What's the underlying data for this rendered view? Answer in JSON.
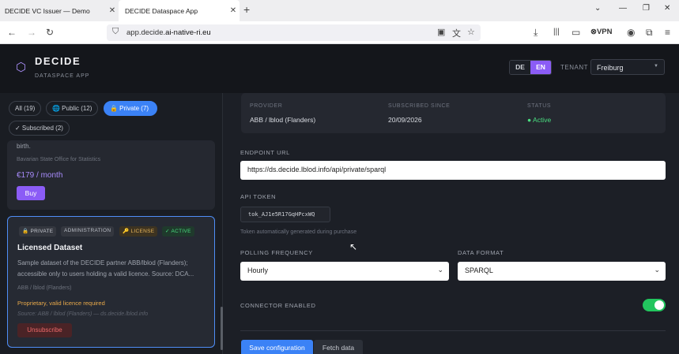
{
  "browser": {
    "tabs": [
      {
        "title": "DECIDE VC Issuer — Demo",
        "active": false
      },
      {
        "title": "DECIDE Dataspace App",
        "active": true
      }
    ],
    "url_prefix": "app.decide.",
    "url_domain": "ai-native-ri.eu",
    "vpn_label": "VPN"
  },
  "header": {
    "brand": "DECIDE",
    "subtitle": "DATASPACE APP",
    "lang_de": "DE",
    "lang_en": "EN",
    "tenant_label": "TENANT",
    "tenant_value": "Freiburg"
  },
  "filters": {
    "all": "All (19)",
    "public": "🌐 Public (12)",
    "private": "🔒 Private (7)",
    "subscribed": "✓ Subscribed (2)"
  },
  "card_prev": {
    "text_tail": "birth.",
    "org": "Bavarian State Office for Statistics",
    "price": "€179 / month",
    "buy_label": "Buy"
  },
  "card_licensed": {
    "badge_private": "🔒 PRIVATE",
    "badge_admin": "ADMINISTRATION",
    "badge_license": "🔑 LICENSE",
    "badge_active": "✓ ACTIVE",
    "title": "Licensed Dataset",
    "description": "Sample dataset of the DECIDE partner ABB/lblod (Flanders); accessible only to users holding a valid licence. Source: DCA...",
    "org": "ABB / lblod (Flanders)",
    "license_note": "Proprietary, valid licence required",
    "source": "Source: ABB / lblod (Flanders) — ds.decide.lblod.info",
    "unsubscribe_label": "Unsubscribe"
  },
  "details": {
    "provider_label": "PROVIDER",
    "provider_value": "ABB / lblod (Flanders)",
    "since_label": "SUBSCRIBED SINCE",
    "since_value": "20/09/2026",
    "status_label": "STATUS",
    "status_value": "● Active",
    "endpoint_label": "ENDPOINT URL",
    "endpoint_value": "https://ds.decide.lblod.info/api/private/sparql",
    "token_label": "API TOKEN",
    "token_value": "tok_AJ1e5R17GqHPcxWQ",
    "token_hint": "Token automatically generated during purchase",
    "polling_label": "POLLING FREQUENCY",
    "polling_value": "Hourly",
    "format_label": "DATA FORMAT",
    "format_value": "SPARQL",
    "connector_label": "CONNECTOR ENABLED",
    "connector_enabled": true,
    "save_label": "Save configuration",
    "fetch_label": "Fetch data"
  },
  "colors": {
    "accent_purple": "#8b5cf6",
    "accent_blue": "#3b82f6",
    "status_green": "#22c55e",
    "danger_red": "#f06a6a",
    "license_amber": "#e8a94a"
  }
}
